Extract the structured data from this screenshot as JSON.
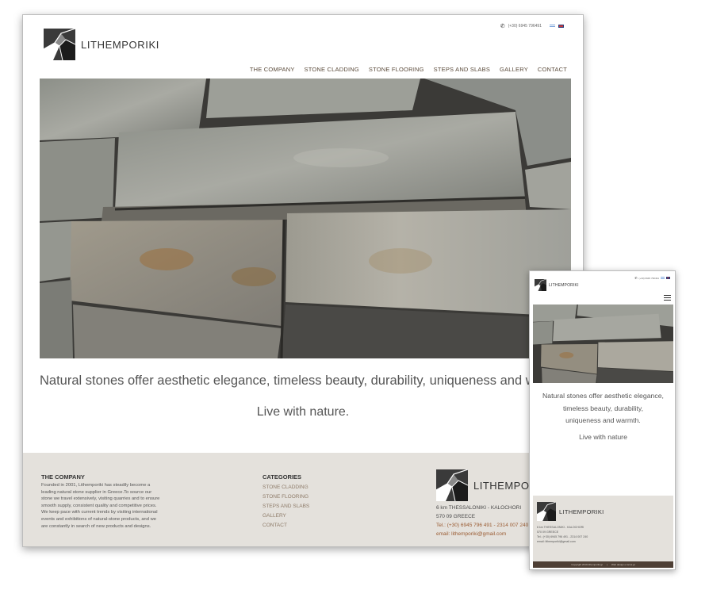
{
  "brand": "LITHEMPORIKI",
  "header": {
    "phone": "(+30) 6945 796491",
    "languages": [
      "gr-flag-icon",
      "uk-flag-icon"
    ]
  },
  "nav": {
    "items": [
      {
        "label": "THE COMPANY"
      },
      {
        "label": "STONE CLADDING"
      },
      {
        "label": "STONE FLOORING"
      },
      {
        "label": "STEPS AND SLABS"
      },
      {
        "label": "GALLERY"
      },
      {
        "label": "CONTACT"
      }
    ]
  },
  "hero": {
    "tagline": "Natural stones offer aesthetic elegance, timeless beauty, durability, uniqueness and warmth.",
    "tagline_desktop_visible": "Natural stones offer aesthetic elegance, timeless beauty, durability, uniqueness and w",
    "subline": "Live with nature."
  },
  "footer": {
    "company_title": "THE COMPANY",
    "company_text": "Founded in 2001, Lithemporiki has steadily become a leading natural stone supplier in Greece.To source our stone we travel extensively, visiting quarries and to ensure smooth supply, consistent quality and competitive prices. We keep pace with current trends by visiting international events and exhibitions of natural-stone products, and we are constantly in search of new products and designs.",
    "categories_title": "CATEGORIES",
    "categories": [
      "STONE CLADDING",
      "STONE FLOORING",
      "STEPS AND SLABS",
      "GALLERY",
      "CONTACT"
    ],
    "address_line1": "6 km  THESSALONIKI - KALOCHORI",
    "address_line2": "570 09  GREECE",
    "tel": "Tel.: (+30) 6945 796 491 - 2314 007 240",
    "email": "email: lithemporiki@gmail.com"
  },
  "mobile": {
    "brand": "LITHEMPORIKI",
    "tagline_lines": [
      "Natural stones offer aesthetic elegance,",
      "timeless beauty, durability,",
      "uniqueness and warmth."
    ],
    "subline": "Live with nature",
    "footer_brand": "LITHEMPORIKI",
    "footer_lines": [
      "6 km  THESSALONIKI - KALOCHORI",
      "570 09  GREECE",
      "Tel.: (+30) 6945 796 491 - 2314 007 240",
      "email: lithemporiki@gmail.com"
    ],
    "copyright": "Copyright 2019 lithemporiki.gr",
    "credit": "Web design e-locus.gr"
  },
  "colors": {
    "footer_bg": "#e4e1dc",
    "link_brown": "#8d7a68",
    "copyright_bar": "#4e3f35"
  }
}
